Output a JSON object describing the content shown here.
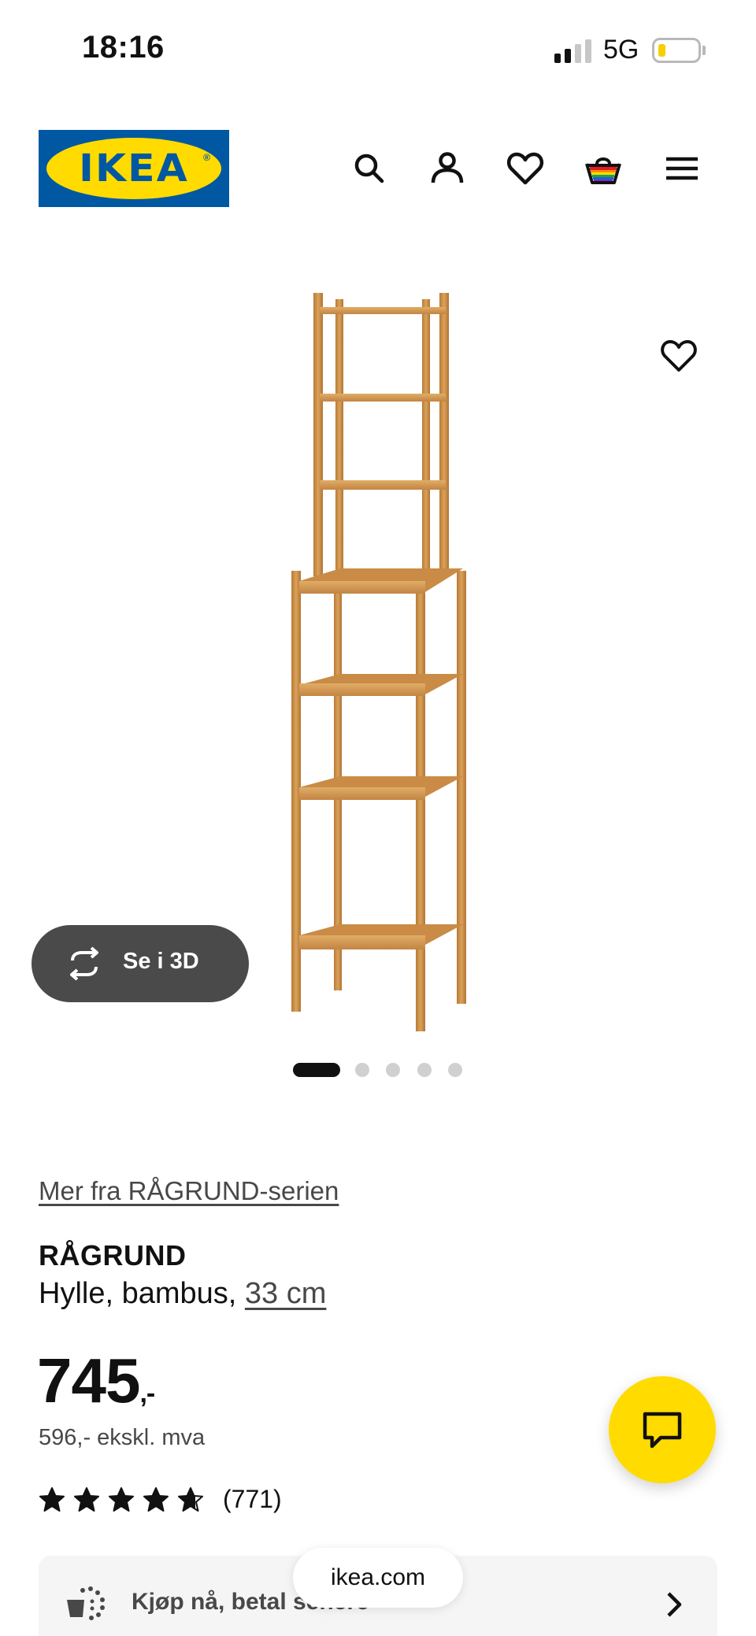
{
  "status_bar": {
    "time": "18:16",
    "network": "5G",
    "battery_level": 0.15,
    "battery_color": "#f5cf00",
    "signal_bars": 2
  },
  "header": {
    "logo_text": "IKEA",
    "logo_registered_mark": "®",
    "brand_blue": "#0058a3",
    "brand_yellow": "#ffdb00",
    "icons": [
      "search-icon",
      "profile-icon",
      "heart-icon",
      "shopping-bag-icon",
      "menu-icon"
    ]
  },
  "gallery": {
    "favorite_icon": "heart-icon",
    "view_3d_label": "Se i 3D",
    "view_3d_icon": "rotate-icon",
    "image_count": 5,
    "active_image_index": 0
  },
  "product": {
    "series_link": "Mer fra RÅGRUND-serien",
    "name": "RÅGRUND",
    "description": "Hylle, bambus, ",
    "size_link": "33 cm",
    "price": "745",
    "price_suffix": ",-",
    "price_excl_vat": "596,- ekskl. mva",
    "rating": 4.7,
    "rating_max": 5,
    "review_count": "(771)"
  },
  "chat": {
    "icon": "chat-icon",
    "color": "#ffdb00"
  },
  "promo": {
    "label": "Kjøp nå, betal senere",
    "icon": "pay-later-icon",
    "chevron_icon": "chevron-right-icon"
  },
  "browser": {
    "url": "ikea.com"
  }
}
